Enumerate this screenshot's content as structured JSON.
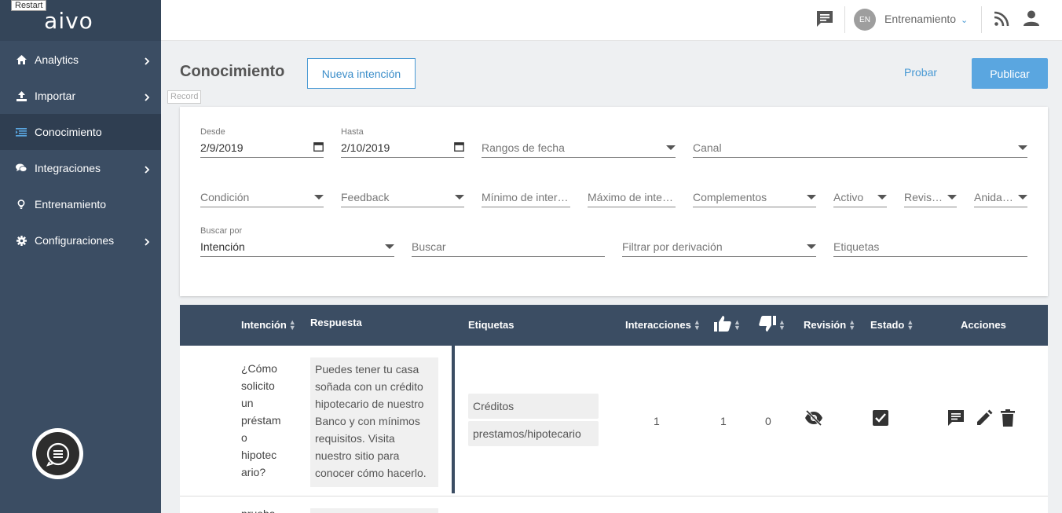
{
  "tooltip": {
    "restart": "Restart",
    "record": "Record"
  },
  "sidebar": {
    "logo": "aivo",
    "items": [
      {
        "label": "Analytics",
        "icon": "home-icon",
        "has_submenu": true
      },
      {
        "label": "Importar",
        "icon": "upload-icon",
        "has_submenu": true
      },
      {
        "label": "Conocimiento",
        "icon": "list-icon",
        "has_submenu": false,
        "active": true
      },
      {
        "label": "Integraciones",
        "icon": "chat-bubbles-icon",
        "has_submenu": true
      },
      {
        "label": "Entrenamiento",
        "icon": "lightbulb-icon",
        "has_submenu": false
      },
      {
        "label": "Configuraciones",
        "icon": "gear-icon",
        "has_submenu": true
      }
    ]
  },
  "topbar": {
    "lang": "EN",
    "environment": "Entrenamiento",
    "environment_caret": "⌵"
  },
  "header": {
    "title": "Conocimiento",
    "new_intent": "Nueva intención",
    "test": "Probar",
    "publish": "Publicar"
  },
  "filters": {
    "desde_label": "Desde",
    "desde_value": "2/9/2019",
    "hasta_label": "Hasta",
    "hasta_value": "2/10/2019",
    "rangos": "Rangos de fecha",
    "canal": "Canal",
    "condicion": "Condición",
    "feedback": "Feedback",
    "min_inter": "Mínimo de interacciones",
    "max_inter": "Máximo de interacciones",
    "complementos": "Complementos",
    "activo": "Activo",
    "revision": "Revisión",
    "anidadas": "Anidadas",
    "buscar_por_label": "Buscar por",
    "buscar_por_value": "Intención",
    "buscar": "Buscar",
    "derivacion": "Filtrar por derivación",
    "etiquetas": "Etiquetas"
  },
  "table": {
    "headers": {
      "intencion": "Intención",
      "respuesta": "Respuesta",
      "etiquetas": "Etiquetas",
      "interacciones": "Interacciones",
      "revision": "Revisión",
      "estado": "Estado",
      "acciones": "Acciones"
    },
    "rows": [
      {
        "intent_lines": [
          "¿Cómo",
          "solicito",
          "un",
          "préstam",
          "o",
          "hipotec",
          "ario?"
        ],
        "response": "Puedes tener tu casa soñada con un crédito hipotecario de nuestro Banco y con mínimos requisitos. Visita nuestro sitio para conocer cómo hacerlo.",
        "tags": [
          "Créditos",
          "prestamos/hipotecario"
        ],
        "interactions": "1",
        "likes": "1",
        "dislikes": "0",
        "revision": "hidden",
        "active": true
      }
    ],
    "next_row_peek": "prueba"
  },
  "colors": {
    "sidebar": "#3b4d63",
    "accent": "#5aa6e0",
    "link": "#4a9ad4"
  }
}
